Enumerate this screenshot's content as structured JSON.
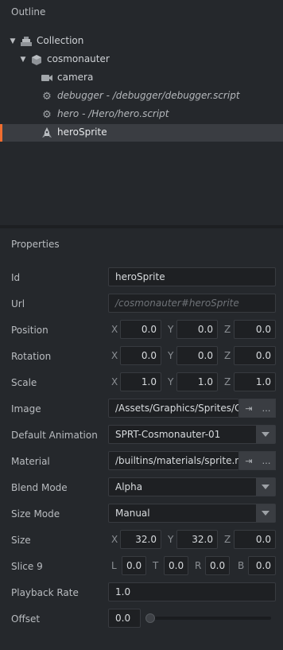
{
  "outline": {
    "title": "Outline",
    "items": [
      {
        "label": "Collection",
        "icon": "collection-icon"
      },
      {
        "label": "cosmonauter",
        "icon": "game-object-icon"
      },
      {
        "label": "camera",
        "icon": "camera-icon"
      },
      {
        "label": "debugger - /debugger/debugger.script",
        "icon": "gear-icon"
      },
      {
        "label": "hero - /Hero/hero.script",
        "icon": "gear-icon"
      },
      {
        "label": "heroSprite",
        "icon": "sprite-icon"
      }
    ]
  },
  "properties": {
    "title": "Properties",
    "id": {
      "label": "Id",
      "value": "heroSprite"
    },
    "url": {
      "label": "Url",
      "placeholder": "/cosmonauter#heroSprite"
    },
    "position": {
      "label": "Position",
      "x": "0.0",
      "y": "0.0",
      "z": "0.0"
    },
    "rotation": {
      "label": "Rotation",
      "x": "0.0",
      "y": "0.0",
      "z": "0.0"
    },
    "scale": {
      "label": "Scale",
      "x": "1.0",
      "y": "1.0",
      "z": "1.0"
    },
    "image": {
      "label": "Image",
      "value": "/Assets/Graphics/Sprites/Co"
    },
    "default_animation": {
      "label": "Default Animation",
      "value": "SPRT-Cosmonauter-01"
    },
    "material": {
      "label": "Material",
      "value": "/builtins/materials/sprite.m"
    },
    "blend_mode": {
      "label": "Blend Mode",
      "value": "Alpha"
    },
    "size_mode": {
      "label": "Size Mode",
      "value": "Manual"
    },
    "size": {
      "label": "Size",
      "x": "32.0",
      "y": "32.0",
      "z": "0.0"
    },
    "slice9": {
      "label": "Slice 9",
      "l": "0.0",
      "t": "0.0",
      "r": "0.0",
      "b": "0.0"
    },
    "playback_rate": {
      "label": "Playback Rate",
      "value": "1.0"
    },
    "offset": {
      "label": "Offset",
      "value": "0.0",
      "slider_fraction": 0.0
    }
  },
  "axis_labels": {
    "x": "X",
    "y": "Y",
    "z": "Z",
    "l": "L",
    "t": "T",
    "r": "R",
    "b": "B"
  },
  "icons": {
    "goto": "⇥",
    "browse": "…"
  },
  "colors": {
    "selection_accent": "#f06d2f",
    "background": "#25282c",
    "field": "#1e2023"
  }
}
